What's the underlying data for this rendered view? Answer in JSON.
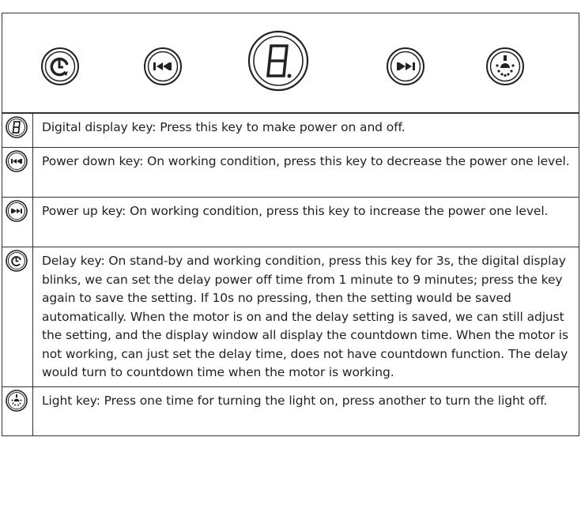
{
  "panel": {
    "display_digit": "8",
    "keys": [
      {
        "name": "delay-key",
        "icon": "clock-icon"
      },
      {
        "name": "power-down-key",
        "icon": "skip-back-icon"
      },
      {
        "name": "digital-display-key",
        "icon": "seven-segment-display-icon"
      },
      {
        "name": "power-up-key",
        "icon": "skip-forward-icon"
      },
      {
        "name": "light-key",
        "icon": "light-icon"
      }
    ]
  },
  "rows": [
    {
      "icon": "seven-segment-display-icon",
      "text": "Digital display key: Press this key to make power on and off."
    },
    {
      "icon": "skip-back-icon",
      "text": "Power down key: On working condition, press this key to decrease the power one level."
    },
    {
      "icon": "skip-forward-icon",
      "text": "Power up key: On working condition, press this key to increase the power one level."
    },
    {
      "icon": "clock-icon",
      "text": "Delay key: On stand-by and working condition, press this key for 3s, the digital display blinks, we can set the delay power off time from 1 minute to 9 minutes; press the key again to save the setting. If 10s no pressing, then the setting would be saved automatically. When the motor is on and the delay setting is saved, we can still adjust the setting, and the display window all display the countdown time. When the motor is not working, can just set the delay time, does not have countdown function. The delay would turn to countdown time when the motor is working."
    },
    {
      "icon": "light-icon",
      "text": "Light key: Press one time for turning the light on, press another to turn the light off."
    }
  ]
}
